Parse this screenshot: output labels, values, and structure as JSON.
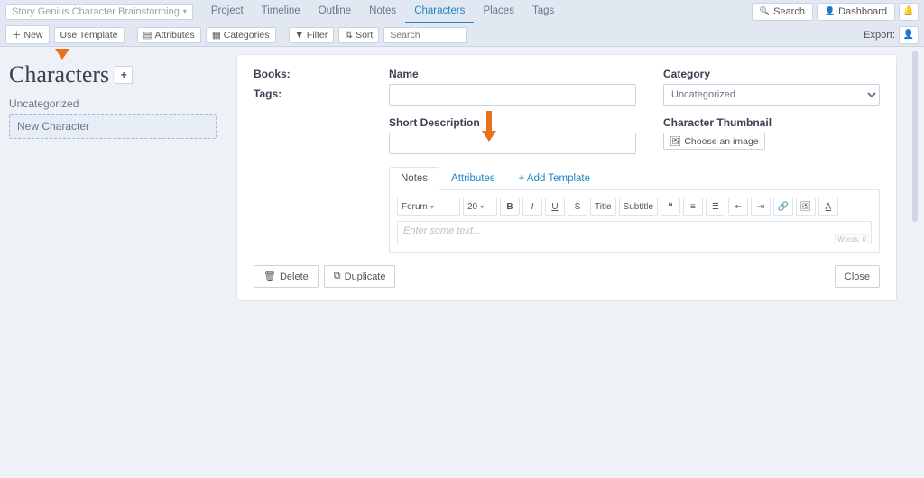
{
  "project_name": "Story Genius Character Brainstorming",
  "nav": {
    "items": [
      "Project",
      "Timeline",
      "Outline",
      "Notes",
      "Characters",
      "Places",
      "Tags"
    ],
    "active": "Characters"
  },
  "top_right": {
    "search": "Search",
    "dashboard": "Dashboard"
  },
  "toolbar": {
    "new": "New",
    "use_template": "Use Template",
    "attributes": "Attributes",
    "categories": "Categories",
    "filter": "Filter",
    "sort": "Sort",
    "search_placeholder": "Search",
    "export": "Export:"
  },
  "sidebar": {
    "title": "Characters",
    "category_label": "Uncategorized",
    "items": [
      {
        "name": "New Character"
      }
    ]
  },
  "form": {
    "books_label": "Books:",
    "tags_label": "Tags:",
    "name_label": "Name",
    "short_desc_label": "Short Description",
    "category_label": "Category",
    "category_value": "Uncategorized",
    "thumb_label": "Character Thumbnail",
    "choose_image": "Choose an image"
  },
  "subtabs": {
    "notes": "Notes",
    "attributes": "Attributes",
    "add_template": "+ Add Template",
    "active": "Notes"
  },
  "editor": {
    "font": "Forum",
    "size": "20",
    "title_btn": "Title",
    "subtitle_btn": "Subtitle",
    "placeholder": "Enter some text...",
    "wordcount": "Words: 0"
  },
  "actions": {
    "delete": "Delete",
    "duplicate": "Duplicate",
    "close": "Close"
  }
}
